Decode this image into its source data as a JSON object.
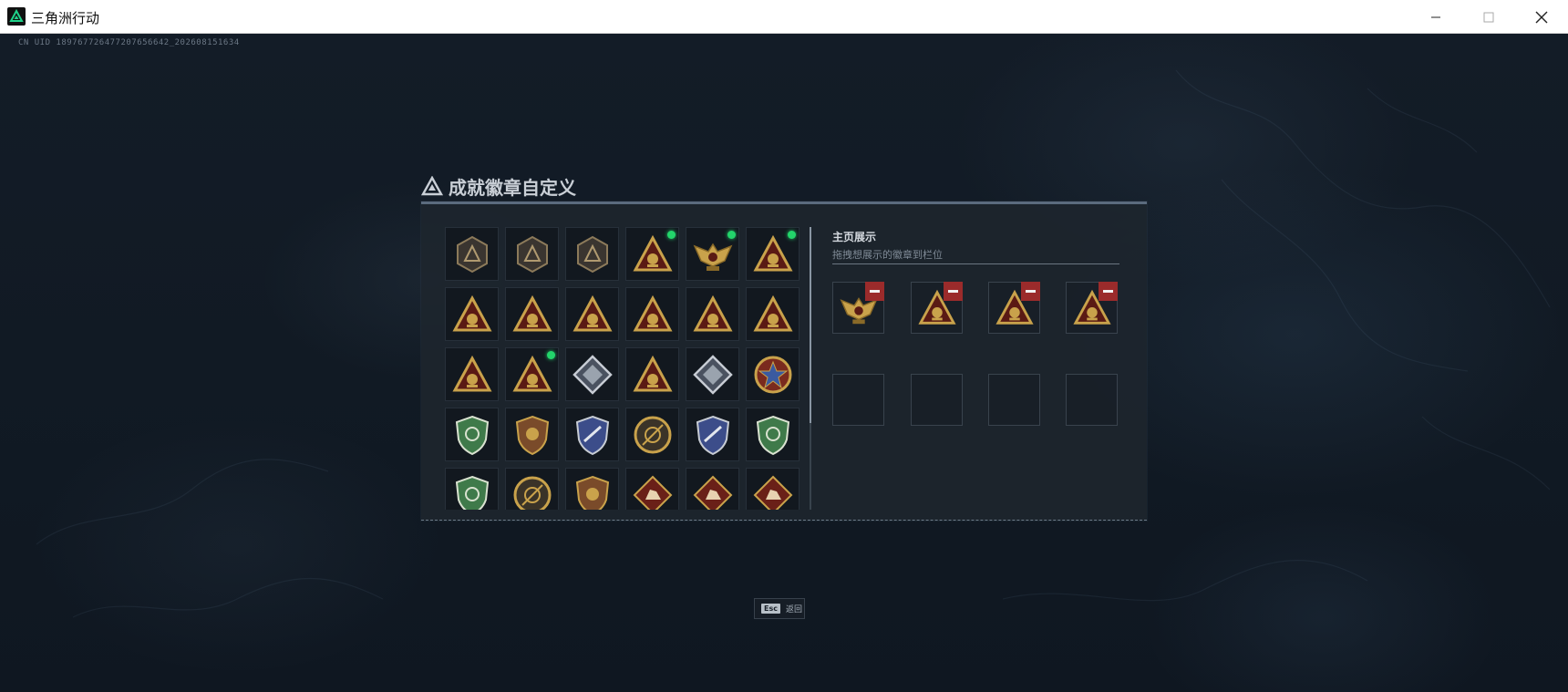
{
  "window": {
    "title": "三角洲行动",
    "controls": [
      "minimize",
      "maximize",
      "close"
    ]
  },
  "uid_text": "CN UID 189767726477207656642_202608151634",
  "panel": {
    "title": "成就徽章自定义",
    "showcase": {
      "title": "主页展示",
      "hint": "拖拽想展示的徽章到栏位"
    }
  },
  "colors": {
    "accent_new": "#23d56b",
    "remove": "#9b2b2b",
    "gold": "#c9a24b",
    "dark_red": "#5a1a14",
    "green": "#3f7a4a",
    "blue": "#3c4d8a"
  },
  "badges": [
    {
      "name": "delta-hex-icon",
      "style": "locked",
      "isNew": false
    },
    {
      "name": "helicopter-shield-icon",
      "style": "locked",
      "isNew": false
    },
    {
      "name": "dagger-shield-icon",
      "style": "locked",
      "isNew": false
    },
    {
      "name": "bomb-triangle-icon",
      "style": "triangle",
      "isNew": true
    },
    {
      "name": "eagle-wings-icon",
      "style": "eagle",
      "isNew": true
    },
    {
      "name": "fifth-triangle-icon",
      "style": "triangle",
      "isNew": true
    },
    {
      "name": "fist-triangle-icon",
      "style": "triangle",
      "isNew": false
    },
    {
      "name": "helmet-triangle-icon",
      "style": "triangle",
      "isNew": false
    },
    {
      "name": "number-1-triangle-icon",
      "style": "triangle",
      "isNew": false
    },
    {
      "name": "number-2-triangle-icon",
      "style": "triangle",
      "isNew": false
    },
    {
      "name": "bottle-triangle-icon",
      "style": "triangle",
      "isNew": false
    },
    {
      "name": "hands-triangle-icon",
      "style": "triangle",
      "isNew": false
    },
    {
      "name": "crossed-triangle-icon",
      "style": "triangle",
      "isNew": false
    },
    {
      "name": "rocket-triangle-icon",
      "style": "triangle",
      "isNew": true
    },
    {
      "name": "heart-diamond-icon",
      "style": "silver",
      "isNew": false
    },
    {
      "name": "figure-triangle-icon",
      "style": "triangle",
      "isNew": false
    },
    {
      "name": "rifle-diamond-icon",
      "style": "silver",
      "isNew": false
    },
    {
      "name": "star-medal-icon",
      "style": "medal",
      "isNew": false
    },
    {
      "name": "green-shield-icon",
      "style": "green",
      "isNew": false
    },
    {
      "name": "bronze-shield-icon",
      "style": "bronze",
      "isNew": false
    },
    {
      "name": "blue-star-shield-icon",
      "style": "blue",
      "isNew": false
    },
    {
      "name": "compass-circle-icon",
      "style": "circle",
      "isNew": false
    },
    {
      "name": "sword-shield-icon",
      "style": "blue",
      "isNew": false
    },
    {
      "name": "green-sword-shield-icon",
      "style": "green",
      "isNew": false
    },
    {
      "name": "green-rifle-shield-icon",
      "style": "green",
      "isNew": false
    },
    {
      "name": "slash-circle-icon",
      "style": "circle",
      "isNew": false
    },
    {
      "name": "wing-shield-icon",
      "style": "bronze",
      "isNew": false
    },
    {
      "name": "horse-diamond-icon",
      "style": "diamond-red",
      "isNew": false
    },
    {
      "name": "wolf-diamond-icon",
      "style": "diamond-red",
      "isNew": false
    },
    {
      "name": "rider-diamond-icon",
      "style": "diamond-red",
      "isNew": false
    }
  ],
  "showcase_slots": [
    {
      "name": "eagle-wings-icon",
      "style": "eagle",
      "filled": true
    },
    {
      "name": "fifth-triangle-icon",
      "style": "triangle",
      "filled": true
    },
    {
      "name": "bomb-triangle-icon",
      "style": "triangle",
      "filled": true
    },
    {
      "name": "rocket-triangle-icon",
      "style": "triangle",
      "filled": true
    },
    {
      "name": "empty-slot",
      "style": "empty",
      "filled": false
    },
    {
      "name": "empty-slot",
      "style": "empty",
      "filled": false
    },
    {
      "name": "empty-slot",
      "style": "empty",
      "filled": false
    },
    {
      "name": "empty-slot",
      "style": "empty",
      "filled": false
    }
  ],
  "esc": {
    "key": "Esc",
    "label": "返回"
  }
}
